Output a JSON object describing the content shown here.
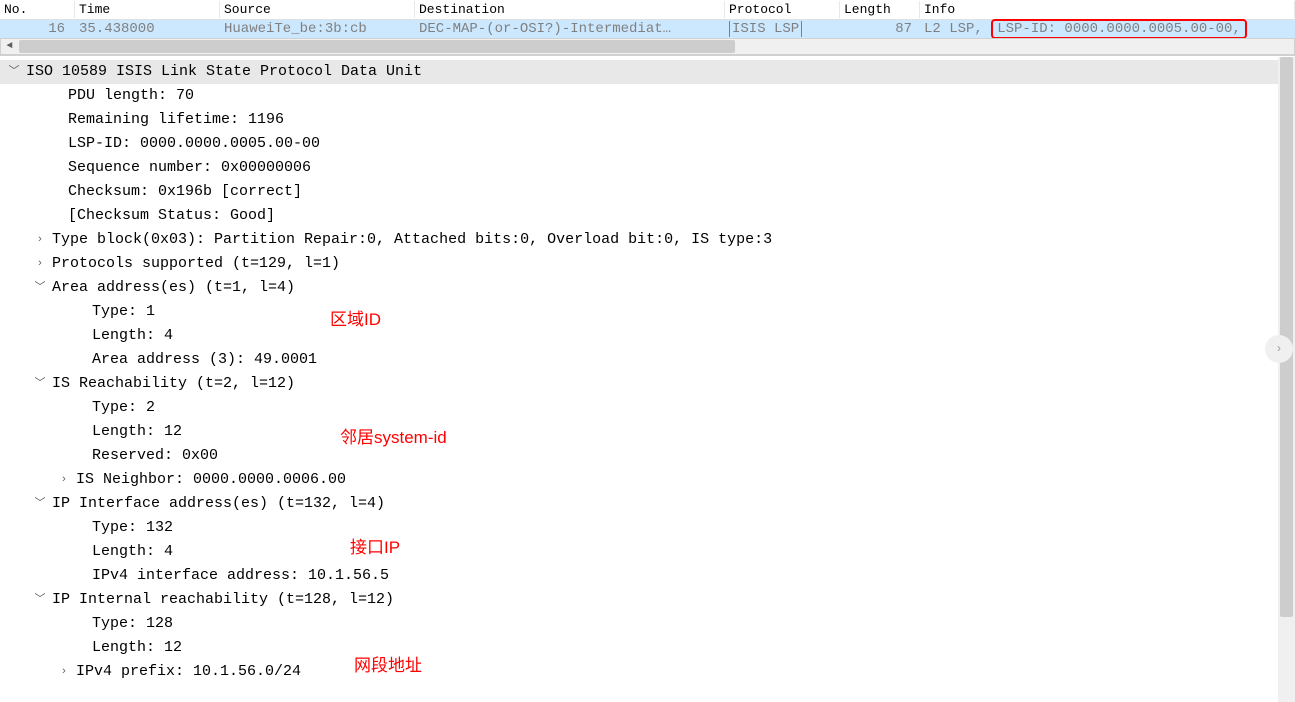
{
  "columns": {
    "no": "No.",
    "time": "Time",
    "source": "Source",
    "destination": "Destination",
    "protocol": "Protocol",
    "length": "Length",
    "info": "Info"
  },
  "packet": {
    "no": "16",
    "time": "35.438000",
    "source": "HuaweiTe_be:3b:cb",
    "destination": "DEC-MAP-(or-OSI?)-Intermediat…",
    "protocol": "ISIS LSP",
    "length": "87",
    "info_prefix": "L2 LSP,",
    "info_highlight": "LSP-ID: 0000.0000.0005.00-00,"
  },
  "details": {
    "root": "ISO 10589 ISIS Link State Protocol Data Unit",
    "pdu_length": "PDU length: 70",
    "remaining_lifetime": "Remaining lifetime: 1196",
    "lsp_id": "LSP-ID: 0000.0000.0005.00-00",
    "sequence_number": "Sequence number: 0x00000006",
    "checksum": "Checksum: 0x196b [correct]",
    "checksum_status": "[Checksum Status: Good]",
    "type_block": "Type block(0x03): Partition Repair:0, Attached bits:0, Overload bit:0, IS type:3",
    "protocols_supported": "Protocols supported (t=129, l=1)",
    "area_addresses": "Area address(es) (t=1, l=4)",
    "area_type": "Type: 1",
    "area_length": "Length: 4",
    "area_address": "Area address (3): 49.0001",
    "is_reachability": "IS Reachability (t=2, l=12)",
    "is_type": "Type: 2",
    "is_length": "Length: 12",
    "is_reserved": "Reserved: 0x00",
    "is_neighbor": "IS Neighbor: 0000.0000.0006.00",
    "ip_interface": "IP Interface address(es) (t=132, l=4)",
    "ip_int_type": "Type: 132",
    "ip_int_length": "Length: 4",
    "ip_int_addr": "IPv4 interface address: 10.1.56.5",
    "ip_internal": "IP Internal reachability (t=128, l=12)",
    "ip_ir_type": "Type: 128",
    "ip_ir_length": "Length: 12",
    "ip_ir_prefix": "IPv4 prefix: 10.1.56.0/24"
  },
  "annotations": {
    "area_id": "区域ID",
    "neighbor_system_id": "邻居system-id",
    "interface_ip": "接口IP",
    "network_address": "网段地址"
  }
}
